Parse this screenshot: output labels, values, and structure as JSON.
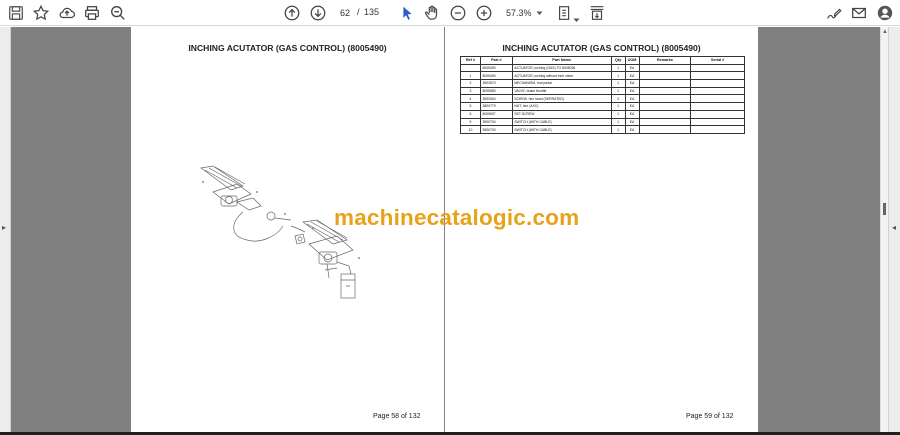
{
  "toolbar": {
    "icons": [
      "save-icon",
      "star-icon",
      "upload-icon",
      "print-icon",
      "search-zoom-icon",
      "page-up-icon",
      "page-down-icon",
      "select-cursor-icon",
      "hand-icon",
      "zoom-out-icon",
      "zoom-in-icon",
      "fit-page-icon",
      "scroll-mode-icon",
      "sign-icon",
      "mail-icon",
      "account-icon"
    ],
    "page_current": "62",
    "page_separator": "/",
    "page_total": "135",
    "zoom": "57.3%"
  },
  "pages": {
    "left": {
      "title": "INCHING ACUTATOR (GAS CONTROL) (8005490)",
      "footer": "Page 58 of 132"
    },
    "right": {
      "title": "INCHING ACUTATOR (GAS CONTROL) (8005490)",
      "footer": "Page 59 of 132",
      "table": {
        "headers": [
          "Ref #",
          "Part #",
          "Part Name",
          "Qty",
          "UOM",
          "Remarks",
          "Serial #"
        ],
        "rows": [
          [
            "",
            "8005490",
            "ACTUATOR, inching (GAS) TO 8005036",
            "1",
            "EA",
            "",
            ""
          ],
          [
            "1",
            "8005494",
            "ACTUATOR, inching without inch valve",
            "1",
            "EA",
            "",
            ""
          ],
          [
            "2",
            "3902870",
            "MECHANISM, foot pedal",
            "1",
            "EA",
            "",
            ""
          ],
          [
            "3",
            "8005580",
            "VALVE, brake throttle",
            "1",
            "EA",
            "",
            ""
          ],
          [
            "4",
            "3902504",
            "SCREW, hex head (SERRATED)",
            "3",
            "EA",
            "",
            ""
          ],
          [
            "5",
            "3800779",
            "NUT, hex (AXC)",
            "1",
            "EA",
            "",
            ""
          ],
          [
            "6",
            "8005507",
            "SET-SCREW",
            "1",
            "EA",
            "",
            ""
          ],
          [
            "9",
            "3900704",
            "SWITCH (WITH CABLE)",
            "1",
            "EA",
            "",
            ""
          ],
          [
            "10",
            "3900700",
            "SWITCH (WITH CABLE)",
            "1",
            "EA",
            "",
            ""
          ]
        ]
      }
    }
  },
  "watermark": "machinecatalogic.com",
  "colors": {
    "viewer_bg": "#808080",
    "watermark": "#e8a21a",
    "accent": "#3b6fd9"
  }
}
